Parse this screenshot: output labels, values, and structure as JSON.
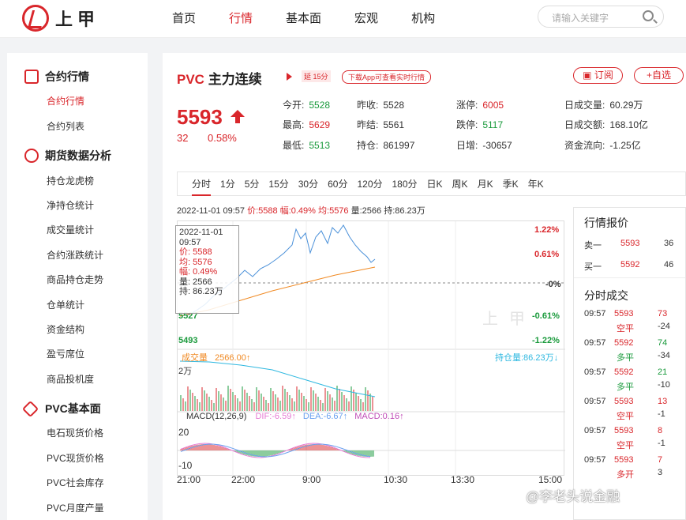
{
  "brand": {
    "name": "上甲"
  },
  "nav": {
    "items": [
      "首页",
      "行情",
      "基本面",
      "宏观",
      "机构"
    ],
    "active": 1
  },
  "search": {
    "placeholder": "请输入关键字"
  },
  "sidebar": {
    "sections": [
      {
        "title": "合约行情",
        "items": [
          "合约行情",
          "合约列表"
        ]
      },
      {
        "title": "期货数据分析",
        "items": [
          "持仓龙虎榜",
          "净持仓统计",
          "成交量统计",
          "合约涨跌统计",
          "商品持仓走势",
          "仓单统计",
          "资金结构",
          "盈亏席位",
          "商品投机度"
        ]
      },
      {
        "title": "PVC基本面",
        "items": [
          "电石现货价格",
          "PVC现货价格",
          "PVC社会库存",
          "PVC月度产量"
        ]
      }
    ]
  },
  "contract": {
    "code": "PVC",
    "name": "主力连续",
    "delay": "延 15分",
    "app_tag": "下载App可查看实时行情",
    "subscribe": "订阅",
    "add": "+自选",
    "price": "5593",
    "change": "32",
    "change_pct": "0.58%"
  },
  "stats": [
    {
      "label": "今开:",
      "value": "5528",
      "color": "green"
    },
    {
      "label": "昨收:",
      "value": "5528",
      "color": "blk"
    },
    {
      "label": "涨停:",
      "value": "6005",
      "color": "red"
    },
    {
      "label": "日成交量:",
      "value": "60.29万",
      "color": "blk"
    },
    {
      "label": "最高:",
      "value": "5629",
      "color": "red"
    },
    {
      "label": "昨结:",
      "value": "5561",
      "color": "blk"
    },
    {
      "label": "跌停:",
      "value": "5117",
      "color": "green"
    },
    {
      "label": "日成交额:",
      "value": "168.10亿",
      "color": "blk"
    },
    {
      "label": "最低:",
      "value": "5513",
      "color": "green"
    },
    {
      "label": "持仓:",
      "value": "861997",
      "color": "blk"
    },
    {
      "label": "日增:",
      "value": "-30657",
      "color": "blk"
    },
    {
      "label": "资金流向:",
      "value": "-1.25亿",
      "color": "blk"
    }
  ],
  "tabs": [
    "分时",
    "1分",
    "5分",
    "15分",
    "30分",
    "60分",
    "120分",
    "180分",
    "日K",
    "周K",
    "月K",
    "季K",
    "年K"
  ],
  "info_line": {
    "datetime": "2022-11-01 09:57",
    "price": "价:5588",
    "amp": "幅:0.49%",
    "avg": "均:5576",
    "vol": "量:2566",
    "oi": "持:86.23万"
  },
  "chart": {
    "y_left": [
      "5527",
      "5493"
    ],
    "y_right": [
      "1.22%",
      "0.61%",
      "-0%",
      "-0.61%",
      "-1.22%"
    ],
    "watermark": "上甲",
    "vol_label": "成交量",
    "vol_value": "2566.00↑",
    "vol_axis": "2万",
    "oi_label": "持仓量:86.23万↓",
    "macd_label": "MACD(12,26,9)",
    "dif": "DIF:-6.59↑",
    "dea": "DEA:-6.67↑",
    "macd": "MACD:0.16↑",
    "macd_axis": [
      "20",
      "-10"
    ],
    "times": [
      "21:00",
      "22:00",
      "9:00",
      "10:30",
      "13:30",
      "15:00"
    ]
  },
  "tooltip": {
    "date": "2022-11-01",
    "time": "09:57",
    "price": "价: 5588",
    "avg": "均: 5576",
    "amp": "幅: 0.49%",
    "vol": "量: 2566",
    "oi": "持: 86.23万"
  },
  "quote": {
    "title": "行情报价",
    "ask": {
      "label": "卖一",
      "price": "5593",
      "vol": "36"
    },
    "bid": {
      "label": "买一",
      "price": "5592",
      "vol": "46"
    },
    "trades_title": "分时成交",
    "trades": [
      {
        "time": "09:57",
        "price": "5593",
        "vol": "73",
        "type": "空平",
        "oi": "-24",
        "price_color": "red",
        "vol_color": "red"
      },
      {
        "time": "09:57",
        "price": "5592",
        "vol": "74",
        "type": "多平",
        "oi": "-34",
        "price_color": "red",
        "vol_color": "green"
      },
      {
        "time": "09:57",
        "price": "5592",
        "vol": "21",
        "type": "多平",
        "oi": "-10",
        "price_color": "red",
        "vol_color": "green"
      },
      {
        "time": "09:57",
        "price": "5593",
        "vol": "13",
        "type": "空平",
        "oi": "-1",
        "price_color": "red",
        "vol_color": "red"
      },
      {
        "time": "09:57",
        "price": "5593",
        "vol": "8",
        "type": "空平",
        "oi": "-1",
        "price_color": "red",
        "vol_color": "red"
      },
      {
        "time": "09:57",
        "price": "5593",
        "vol": "7",
        "type": "多开",
        "oi": "3",
        "price_color": "red",
        "vol_color": "red"
      }
    ]
  },
  "footer_watermark": "@李老头说金融",
  "colors": {
    "accent": "#d9262b",
    "down": "#1a9a3c",
    "price_line": "#4a90d9",
    "avg_line": "#f08a24",
    "oi_line": "#2fb8e0"
  }
}
